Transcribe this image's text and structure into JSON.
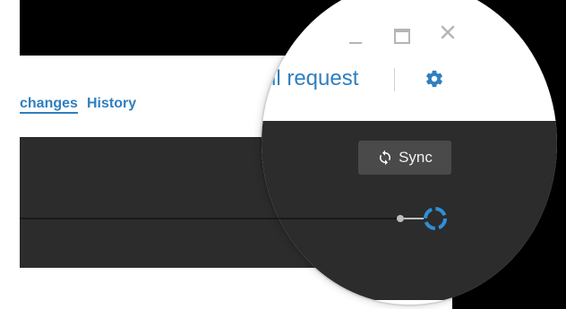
{
  "tabs": {
    "changes": "changes",
    "history": "History"
  },
  "header": {
    "pull_request_label": "ll request",
    "sync_label": "Sync"
  },
  "colors": {
    "accent": "#2f7fbf",
    "dark_bar": "#2c2c2c",
    "sync_button_bg": "#4a4a4a",
    "spinner": "#2f8fd8"
  },
  "icons": {
    "window_minimize": "minimize-icon",
    "window_maximize": "maximize-icon",
    "window_close": "close-icon",
    "settings": "gear-icon",
    "sync": "sync-icon",
    "timeline_node": "timeline-node-icon",
    "spinner": "spinner-icon"
  }
}
